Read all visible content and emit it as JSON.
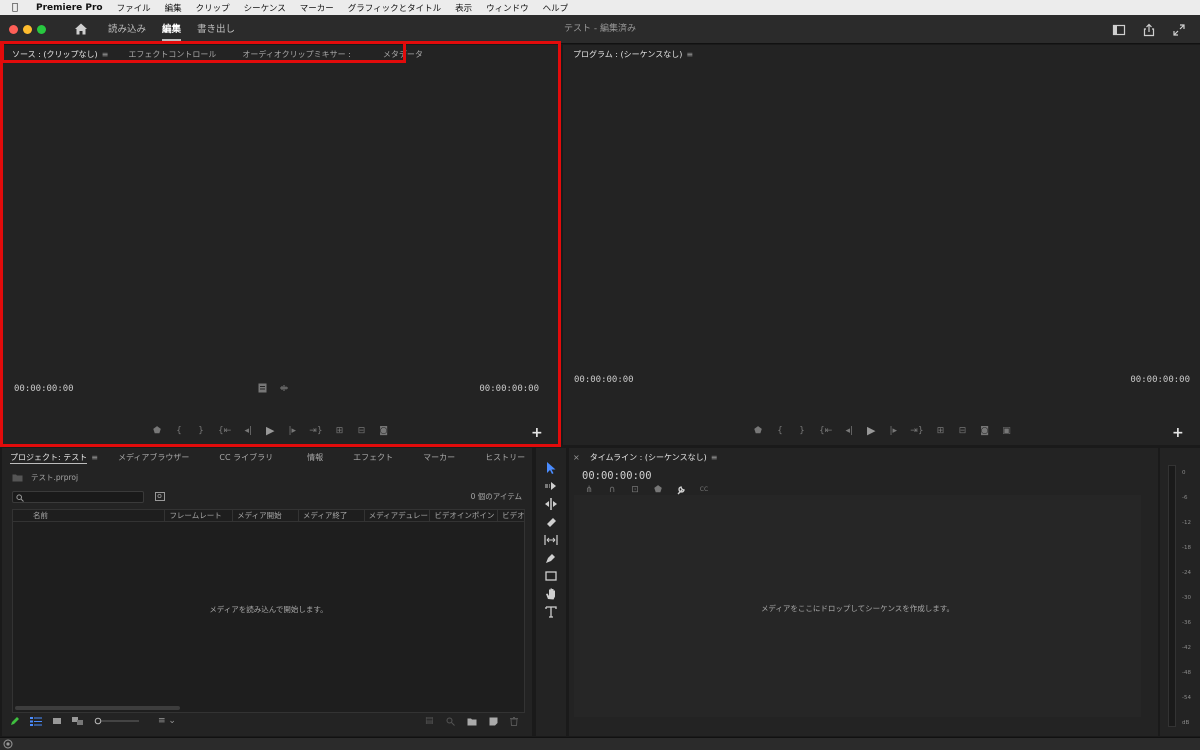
{
  "menubar": {
    "app_name": "Premiere Pro",
    "items": [
      "ファイル",
      "編集",
      "クリップ",
      "シーケンス",
      "マーカー",
      "グラフィックとタイトル",
      "表示",
      "ウィンドウ",
      "ヘルプ"
    ]
  },
  "titlebar": {
    "workspace_tabs": [
      {
        "label": "読み込み",
        "active": false
      },
      {
        "label": "編集",
        "active": true
      },
      {
        "label": "書き出し",
        "active": false
      }
    ],
    "window_title": "テスト - 編集済み"
  },
  "source_panel": {
    "tabs": [
      {
        "label": "ソース : (クリップなし)",
        "active": true,
        "has_menu": true
      },
      {
        "label": "エフェクトコントロール",
        "active": false
      },
      {
        "label": "オーディオクリップミキサー :",
        "active": false
      },
      {
        "label": "メタデータ",
        "active": false
      }
    ],
    "timecode_left": "00:00:00:00",
    "timecode_right": "00:00:00:00"
  },
  "program_panel": {
    "tab_label": "プログラム : (シーケンスなし)",
    "timecode_left": "00:00:00:00",
    "timecode_right": "00:00:00:00"
  },
  "project_panel": {
    "tabs": [
      {
        "label": "プロジェクト: テスト",
        "active": true
      },
      {
        "label": "メディアブラウザー",
        "active": false
      },
      {
        "label": "CC ライブラリ",
        "active": false
      },
      {
        "label": "情報",
        "active": false
      },
      {
        "label": "エフェクト",
        "active": false
      },
      {
        "label": "マーカー",
        "active": false
      },
      {
        "label": "ヒストリー",
        "active": false
      }
    ],
    "file_name": "テスト.prproj",
    "item_count": "0 個のアイテム",
    "columns": [
      "名前",
      "フレームレート",
      "メディア開始",
      "メディア終了",
      "メディアデュレー",
      "ビデオインポイン",
      "ビデオ"
    ],
    "empty_message": "メディアを読み込んで開始します。"
  },
  "timeline_panel": {
    "tab_label": "タイムライン : (シーケンスなし)",
    "timecode": "00:00:00:00",
    "empty_message": "メディアをここにドロップしてシーケンスを作成します。"
  },
  "audio_meter": {
    "labels": [
      "0",
      "-6",
      "-12",
      "-18",
      "-24",
      "-30",
      "-36",
      "-42",
      "-48",
      "-54",
      "dB"
    ]
  },
  "colors": {
    "highlight": "#e20b0b",
    "selection_tool": "#4a8cff",
    "record_icon": "#3fbf3f"
  }
}
